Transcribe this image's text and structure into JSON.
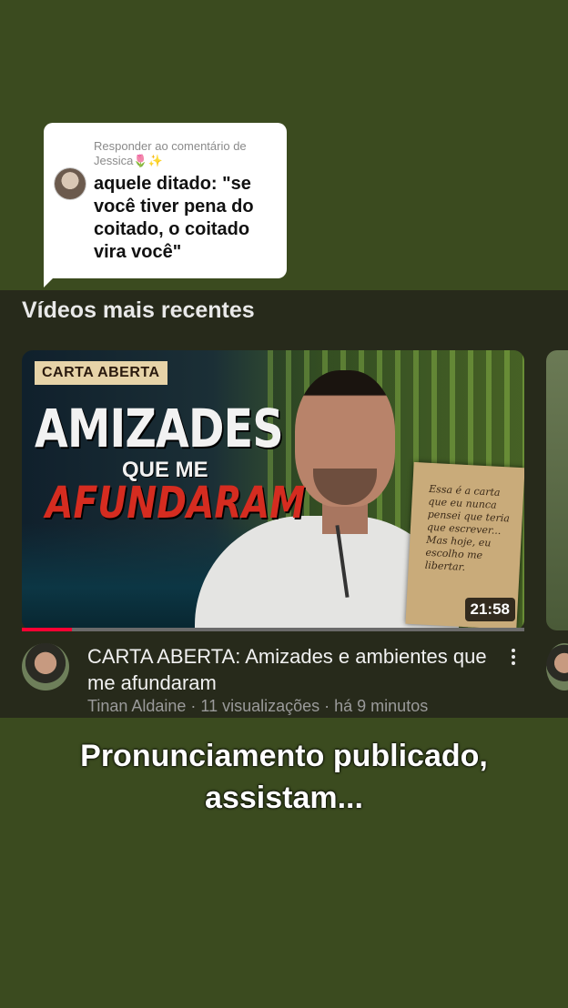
{
  "reply": {
    "header": "Responder ao comentário de Jessica🌷✨",
    "text": "aquele ditado: \"se você tiver pena do coitado, o coitado vira você\""
  },
  "section": {
    "title": "Vídeos mais recentes"
  },
  "video": {
    "thumbnail_badge": "CARTA ABERTA",
    "thumbnail_title_1": "AMIZADES",
    "thumbnail_title_2": "QUE ME",
    "thumbnail_title_3": "AFUNDARAM",
    "letter_text": "Essa é a carta que eu nunca pensei que teria que escrever... Mas hoje, eu escolho me libertar.",
    "duration": "21:58",
    "watched_fraction": 0.1,
    "title": "CARTA ABERTA: Amizades e ambientes que me afundaram",
    "meta": "Tinan Aldaine · 11 visualizações · há 9 minutos"
  },
  "caption": "Pronunciamento publicado, assistam...",
  "colors": {
    "background": "#3b4b1f",
    "panel": "#272a1b",
    "progress": "#ff0033",
    "thumbnail_red": "#d52c20"
  },
  "icons": {
    "more_options": "kebab-vertical-icon"
  }
}
